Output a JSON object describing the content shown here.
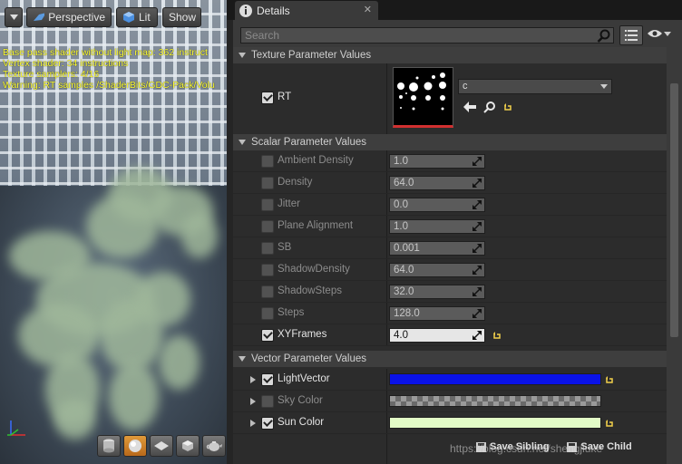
{
  "viewport": {
    "perspective_label": "Perspective",
    "lit_label": "Lit",
    "show_label": "Show",
    "stats": [
      "Base pass shader without light map: 362 instruct",
      "Vertex shader: 34 instructions",
      "Texture samplers: 4/16",
      "Warning: RT samples /ShaderBits/GDC-Pack/Volu"
    ]
  },
  "details": {
    "tab_title": "Details",
    "search_placeholder": "Search",
    "texture_section": "Texture Parameter Values",
    "rt_label": "RT",
    "rt_texture_name": "c",
    "scalar_section": "Scalar Parameter Values",
    "scalars": [
      {
        "label": "Ambient Density",
        "value": "1.0",
        "enabled": false
      },
      {
        "label": "Density",
        "value": "64.0",
        "enabled": false
      },
      {
        "label": "Jitter",
        "value": "0.0",
        "enabled": false
      },
      {
        "label": "Plane Alignment",
        "value": "1.0",
        "enabled": false
      },
      {
        "label": "SB",
        "value": "0.001",
        "enabled": false
      },
      {
        "label": "ShadowDensity",
        "value": "64.0",
        "enabled": false
      },
      {
        "label": "ShadowSteps",
        "value": "32.0",
        "enabled": false
      },
      {
        "label": "Steps",
        "value": "128.0",
        "enabled": false
      },
      {
        "label": "XYFrames",
        "value": "4.0",
        "enabled": true
      }
    ],
    "vector_section": "Vector Parameter Values",
    "vectors": [
      {
        "label": "LightVector",
        "enabled": true,
        "color": "#0a12e8"
      },
      {
        "label": "Sky Color",
        "enabled": false,
        "color": "checker"
      },
      {
        "label": "Sun Color",
        "enabled": true,
        "color": "#e2fbc6"
      }
    ],
    "footer_watermark": "https://blog.csdn.net/shengjiuke",
    "save_sibling_label": "Save Sibling",
    "save_child_label": "Save Child"
  },
  "colors": {
    "accent_orange": "#e09a3a",
    "reset_yellow": "#f2d04b",
    "stats_yellow": "#ffff33"
  }
}
